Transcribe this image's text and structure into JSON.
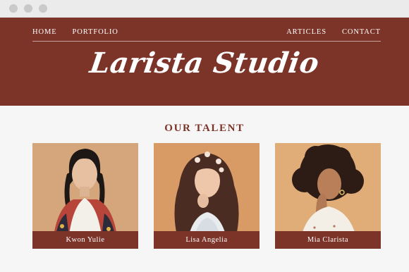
{
  "nav": {
    "left": [
      "HOME",
      "PORTFOLIO"
    ],
    "right": [
      "ARTICLES",
      "CONTACT"
    ]
  },
  "brand": {
    "name": "Larista Studio"
  },
  "section": {
    "title": "OUR TALENT"
  },
  "talent": [
    {
      "name": "Kwon Yulie",
      "bg": "#d8a87c"
    },
    {
      "name": "Lisa Angelia",
      "bg": "#d79a66"
    },
    {
      "name": "Mia Clarista",
      "bg": "#e2b07b"
    }
  ],
  "colors": {
    "brand": "#7c3429",
    "page": "#f6f6f6"
  }
}
